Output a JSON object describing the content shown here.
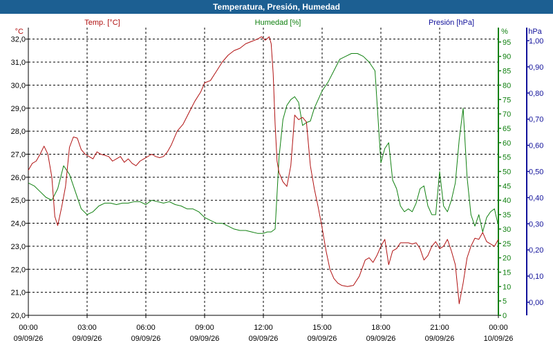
{
  "window": {
    "title": "Temperatura, Presión, Humedad"
  },
  "chart_data": {
    "type": "line",
    "title": "Temperatura, Presión, Humedad",
    "colors": {
      "temp": "#b01010",
      "hum": "#108010",
      "pres": "#10109a",
      "grid": "#000000",
      "frame": "#000000"
    },
    "axes": {
      "temp": {
        "unit": "°C",
        "min": 20,
        "max": 32.5,
        "ticks": [
          "20,0",
          "21,0",
          "22,0",
          "23,0",
          "24,0",
          "25,0",
          "26,0",
          "27,0",
          "28,0",
          "29,0",
          "30,0",
          "31,0",
          "32,0"
        ]
      },
      "hum": {
        "unit": "%",
        "min": 0,
        "max": 100,
        "ticks": [
          "0",
          "5",
          "10",
          "15",
          "20",
          "25",
          "30",
          "35",
          "40",
          "45",
          "50",
          "55",
          "60",
          "65",
          "70",
          "75",
          "80",
          "85",
          "90",
          "95"
        ]
      },
      "pres": {
        "unit": "hPa",
        "min": -0.05,
        "max": 1.05,
        "ticks": [
          "0,00",
          "0,10",
          "0,20",
          "0,30",
          "0,40",
          "0,50",
          "0,60",
          "0,70",
          "0,80",
          "0,90",
          "1,00"
        ]
      }
    },
    "x_ticks": [
      {
        "time": "00:00",
        "date": "09/09/26"
      },
      {
        "time": "03:00",
        "date": "09/09/26"
      },
      {
        "time": "06:00",
        "date": "09/09/26"
      },
      {
        "time": "09:00",
        "date": "09/09/26"
      },
      {
        "time": "12:00",
        "date": "09/09/26"
      },
      {
        "time": "15:00",
        "date": "09/09/26"
      },
      {
        "time": "18:00",
        "date": "09/09/26"
      },
      {
        "time": "21:00",
        "date": "09/09/26"
      },
      {
        "time": "00:00",
        "date": "10/09/26"
      }
    ],
    "grid": true,
    "series": [
      {
        "name": "Temp. [°C]",
        "axis": "temp",
        "x": [
          0,
          0.2,
          0.4,
          0.6,
          0.8,
          1.0,
          1.2,
          1.35,
          1.5,
          1.7,
          1.9,
          2.1,
          2.3,
          2.5,
          2.7,
          2.9,
          3.1,
          3.3,
          3.5,
          3.7,
          3.9,
          4.1,
          4.3,
          4.5,
          4.7,
          4.9,
          5.1,
          5.3,
          5.5,
          5.7,
          5.9,
          6.1,
          6.3,
          6.5,
          6.7,
          6.9,
          7.1,
          7.3,
          7.6,
          7.9,
          8.2,
          8.5,
          8.8,
          9.0,
          9.3,
          9.6,
          9.9,
          10.2,
          10.5,
          10.8,
          11.1,
          11.4,
          11.7,
          11.9,
          12.1,
          12.3,
          12.4,
          12.5,
          12.6,
          12.7,
          12.8,
          13.0,
          13.2,
          13.4,
          13.6,
          13.8,
          14.0,
          14.2,
          14.4,
          14.6,
          14.8,
          15.0,
          15.2,
          15.4,
          15.6,
          15.8,
          16.0,
          16.3,
          16.6,
          16.9,
          17.2,
          17.4,
          17.6,
          17.8,
          18.0,
          18.2,
          18.4,
          18.6,
          18.8,
          19.0,
          19.2,
          19.4,
          19.6,
          19.8,
          20.0,
          20.2,
          20.4,
          20.6,
          20.8,
          21.0,
          21.2,
          21.4,
          21.6,
          21.8,
          22.0,
          22.2,
          22.4,
          22.6,
          22.8,
          23.0,
          23.2,
          23.4,
          23.6,
          23.8,
          24.0
        ],
        "values": [
          26.3,
          26.6,
          26.7,
          27.0,
          27.35,
          27.0,
          26.0,
          24.3,
          23.9,
          24.7,
          25.6,
          27.3,
          27.75,
          27.7,
          27.2,
          27.0,
          26.9,
          26.8,
          27.1,
          27.0,
          26.95,
          26.9,
          26.7,
          26.8,
          26.9,
          26.65,
          26.8,
          26.6,
          26.5,
          26.7,
          26.8,
          26.9,
          27.0,
          26.9,
          26.85,
          26.9,
          27.1,
          27.4,
          28.0,
          28.3,
          28.8,
          29.3,
          29.7,
          30.1,
          30.2,
          30.6,
          31.0,
          31.3,
          31.5,
          31.6,
          31.8,
          31.9,
          32.0,
          32.1,
          31.95,
          32.1,
          31.8,
          30.5,
          28.3,
          26.7,
          26.2,
          25.8,
          25.6,
          26.5,
          28.7,
          28.5,
          28.6,
          28.4,
          26.5,
          25.5,
          24.7,
          23.8,
          22.8,
          22.0,
          21.6,
          21.4,
          21.3,
          21.25,
          21.3,
          21.7,
          22.4,
          22.5,
          22.3,
          22.6,
          23.0,
          23.3,
          22.2,
          22.8,
          22.9,
          23.15,
          23.15,
          23.15,
          23.1,
          23.15,
          22.9,
          22.4,
          22.6,
          23.0,
          23.2,
          22.9,
          23.0,
          23.3,
          22.8,
          22.2,
          20.5,
          21.4,
          22.5,
          23.0,
          23.35,
          23.3,
          23.6,
          23.2,
          23.1,
          23.0,
          23.3
        ],
        "color": "#b01010"
      },
      {
        "name": "Humedad [%]",
        "axis": "hum",
        "x": [
          0,
          0.3,
          0.6,
          0.9,
          1.2,
          1.5,
          1.8,
          2.1,
          2.4,
          2.7,
          3.0,
          3.3,
          3.6,
          3.9,
          4.2,
          4.5,
          4.8,
          5.1,
          5.4,
          5.7,
          6.0,
          6.3,
          6.6,
          6.9,
          7.2,
          7.5,
          7.8,
          8.1,
          8.4,
          8.7,
          9.0,
          9.3,
          9.6,
          9.9,
          10.2,
          10.5,
          10.8,
          11.1,
          11.4,
          11.7,
          12.0,
          12.2,
          12.4,
          12.6,
          12.8,
          13.0,
          13.2,
          13.4,
          13.6,
          13.8,
          14.0,
          14.2,
          14.4,
          14.6,
          14.8,
          15.0,
          15.3,
          15.6,
          15.9,
          16.2,
          16.5,
          16.8,
          17.1,
          17.4,
          17.7,
          18.0,
          18.2,
          18.4,
          18.6,
          18.8,
          19.0,
          19.2,
          19.4,
          19.6,
          19.8,
          20.0,
          20.2,
          20.4,
          20.6,
          20.8,
          21.0,
          21.2,
          21.4,
          21.6,
          21.8,
          22.0,
          22.2,
          22.4,
          22.6,
          22.8,
          23.0,
          23.2,
          23.4,
          23.6,
          23.8,
          24.0
        ],
        "values": [
          46,
          45,
          43,
          41,
          40,
          44,
          52,
          49,
          43,
          37,
          35,
          36,
          38,
          39,
          39,
          38.5,
          39,
          39,
          39.5,
          39.5,
          38.5,
          40,
          39.5,
          39,
          39.5,
          38.5,
          38,
          37,
          37,
          36,
          34,
          33,
          32,
          32,
          31,
          30,
          29.5,
          29.5,
          29,
          28.5,
          28.5,
          29,
          29,
          30,
          55,
          68,
          73,
          75,
          76,
          74,
          66,
          67,
          67.5,
          72,
          75,
          78,
          81,
          85,
          89,
          90,
          91,
          91,
          90,
          88,
          85,
          53,
          58,
          60,
          47,
          44,
          38,
          36,
          37,
          36,
          39,
          44,
          45,
          38,
          35,
          35,
          50,
          38,
          36,
          40,
          46,
          61,
          72,
          48,
          35,
          31,
          35,
          29,
          34,
          36,
          37,
          31
        ],
        "color": "#108010"
      },
      {
        "name": "Presión [hPa]",
        "axis": "pres",
        "x": [],
        "values": [],
        "color": "#10109a"
      }
    ]
  }
}
